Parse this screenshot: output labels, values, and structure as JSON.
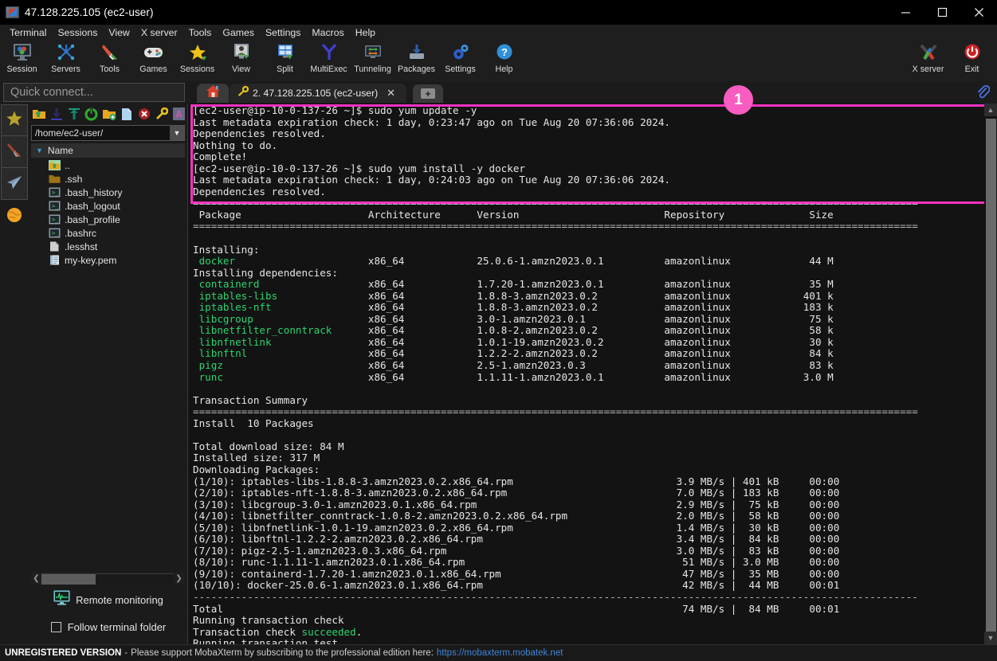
{
  "window": {
    "title": "47.128.225.105 (ec2-user)",
    "icon": "mobaxterm-icon",
    "controls": [
      {
        "name": "minimize-button",
        "glyph": "minimize-icon"
      },
      {
        "name": "maximize-button",
        "glyph": "maximize-icon"
      },
      {
        "name": "close-button",
        "glyph": "close-icon"
      }
    ]
  },
  "menubar": {
    "items": [
      {
        "label": "Terminal"
      },
      {
        "label": "Sessions"
      },
      {
        "label": "View"
      },
      {
        "label": "X server"
      },
      {
        "label": "Tools"
      },
      {
        "label": "Games"
      },
      {
        "label": "Settings"
      },
      {
        "label": "Macros"
      },
      {
        "label": "Help"
      }
    ]
  },
  "toolbar": {
    "buttons": [
      {
        "label": "Session",
        "icon": "session-icon"
      },
      {
        "label": "Servers",
        "icon": "servers-icon"
      },
      {
        "label": "Tools",
        "icon": "tools-icon"
      },
      {
        "label": "Games",
        "icon": "games-icon"
      },
      {
        "label": "Sessions",
        "icon": "sessions-star-icon"
      },
      {
        "label": "View",
        "icon": "view-icon"
      },
      {
        "label": "Split",
        "icon": "split-icon"
      },
      {
        "label": "MultiExec",
        "icon": "multiexec-icon"
      },
      {
        "label": "Tunneling",
        "icon": "tunneling-icon"
      },
      {
        "label": "Packages",
        "icon": "packages-icon"
      },
      {
        "label": "Settings",
        "icon": "settings-gear-icon"
      },
      {
        "label": "Help",
        "icon": "help-icon"
      }
    ],
    "right_buttons": [
      {
        "label": "X server",
        "icon": "xserver-icon"
      },
      {
        "label": "Exit",
        "icon": "exit-power-icon"
      }
    ]
  },
  "quick_connect": {
    "placeholder": "Quick connect..."
  },
  "rail": {
    "items": [
      {
        "name": "sidebar-sessions-star",
        "icon": "star-icon"
      },
      {
        "name": "sidebar-tools",
        "icon": "swiss-knife-icon"
      },
      {
        "name": "sidebar-sftp",
        "icon": "paper-plane-icon"
      },
      {
        "name": "sidebar-globe",
        "icon": "globe-icon"
      }
    ]
  },
  "file_browser": {
    "toolbar_icons": [
      "up-folder-icon",
      "download-icon",
      "upload-icon",
      "refresh-icon",
      "new-folder-icon",
      "new-file-icon",
      "delete-icon",
      "permissions-key-icon",
      "text-mode-icon"
    ],
    "path": "/home/ec2-user/",
    "column_header": "Name",
    "sort_indicator": "sort-descending-icon",
    "files": [
      {
        "name": "..",
        "icon": "parent-folder-icon"
      },
      {
        "name": ".ssh",
        "icon": "folder-icon"
      },
      {
        "name": ".bash_history",
        "icon": "script-file-icon"
      },
      {
        "name": ".bash_logout",
        "icon": "script-file-icon"
      },
      {
        "name": ".bash_profile",
        "icon": "script-file-icon"
      },
      {
        "name": ".bashrc",
        "icon": "script-file-icon"
      },
      {
        "name": ".lesshst",
        "icon": "plain-file-icon"
      },
      {
        "name": "my-key.pem",
        "icon": "certificate-file-icon"
      }
    ],
    "remote_monitoring_label": "Remote monitoring",
    "remote_monitoring_icon": "monitor-graph-icon",
    "follow_terminal_folder_label": "Follow terminal folder",
    "follow_terminal_folder_checked": false
  },
  "tabs": {
    "home_tab_icon": "home-icon",
    "session_tab": {
      "icon": "key-icon",
      "label": "2. 47.128.225.105 (ec2-user)",
      "close_glyph": "close-icon"
    },
    "new_tab_label": "+",
    "clipboard_icon": "paperclip-icon"
  },
  "annotation": {
    "badge_number": "1",
    "highlight_color": "#f734c0",
    "badge_color": "#f85cc0"
  },
  "terminal": {
    "scroll_up_glyph": "chevron-up-icon",
    "scroll_down_glyph": "chevron-down-icon",
    "lines": [
      {
        "t": "[ec2-user@ip-10-0-137-26 ~]$ sudo yum update -y"
      },
      {
        "t": "Last metadata expiration check: 1 day, 0:23:47 ago on Tue Aug 20 07:36:06 2024."
      },
      {
        "t": "Dependencies resolved."
      },
      {
        "t": "Nothing to do."
      },
      {
        "t": "Complete!"
      },
      {
        "t": "[ec2-user@ip-10-0-137-26 ~]$ sudo yum install -y docker"
      },
      {
        "t": "Last metadata expiration check: 1 day, 0:24:03 ago on Tue Aug 20 07:36:06 2024."
      },
      {
        "t": "Dependencies resolved."
      },
      {
        "t": "========================================================================================================================",
        "c": "sep"
      },
      {
        "t": " Package                     Architecture      Version                        Repository              Size"
      },
      {
        "t": "========================================================================================================================",
        "c": "sep"
      },
      {
        "t": ""
      },
      {
        "t": "Installing:"
      },
      {
        "t": " docker",
        "c": "g",
        "rest": "                      x86_64            25.0.6-1.amzn2023.0.1          amazonlinux             44 M"
      },
      {
        "t": "Installing dependencies:"
      },
      {
        "t": " containerd",
        "c": "g",
        "rest": "                  x86_64            1.7.20-1.amzn2023.0.1          amazonlinux             35 M"
      },
      {
        "t": " iptables-libs",
        "c": "g",
        "rest": "               x86_64            1.8.8-3.amzn2023.0.2           amazonlinux            401 k"
      },
      {
        "t": " iptables-nft",
        "c": "g",
        "rest": "                x86_64            1.8.8-3.amzn2023.0.2           amazonlinux            183 k"
      },
      {
        "t": " libcgroup",
        "c": "g",
        "rest": "                   x86_64            3.0-1.amzn2023.0.1             amazonlinux             75 k"
      },
      {
        "t": " libnetfilter_conntrack",
        "c": "g",
        "rest": "      x86_64            1.0.8-2.amzn2023.0.2           amazonlinux             58 k"
      },
      {
        "t": " libnfnetlink",
        "c": "g",
        "rest": "                x86_64            1.0.1-19.amzn2023.0.2          amazonlinux             30 k"
      },
      {
        "t": " libnftnl",
        "c": "g",
        "rest": "                    x86_64            1.2.2-2.amzn2023.0.2           amazonlinux             84 k"
      },
      {
        "t": " pigz",
        "c": "g",
        "rest": "                        x86_64            2.5-1.amzn2023.0.3             amazonlinux             83 k"
      },
      {
        "t": " runc",
        "c": "g",
        "rest": "                        x86_64            1.1.11-1.amzn2023.0.1          amazonlinux            3.0 M"
      },
      {
        "t": ""
      },
      {
        "t": "Transaction Summary"
      },
      {
        "t": "========================================================================================================================",
        "c": "sep"
      },
      {
        "t": "Install  10 Packages"
      },
      {
        "t": ""
      },
      {
        "t": "Total download size: 84 M"
      },
      {
        "t": "Installed size: 317 M"
      },
      {
        "t": "Downloading Packages:"
      },
      {
        "t": "(1/10): iptables-libs-1.8.8-3.amzn2023.0.2.x86_64.rpm                           3.9 MB/s | 401 kB     00:00"
      },
      {
        "t": "(2/10): iptables-nft-1.8.8-3.amzn2023.0.2.x86_64.rpm                            7.0 MB/s | 183 kB     00:00"
      },
      {
        "t": "(3/10): libcgroup-3.0-1.amzn2023.0.1.x86_64.rpm                                 2.9 MB/s |  75 kB     00:00"
      },
      {
        "t": "(4/10): libnetfilter_conntrack-1.0.8-2.amzn2023.0.2.x86_64.rpm                  2.0 MB/s |  58 kB     00:00"
      },
      {
        "t": "(5/10): libnfnetlink-1.0.1-19.amzn2023.0.2.x86_64.rpm                           1.4 MB/s |  30 kB     00:00"
      },
      {
        "t": "(6/10): libnftnl-1.2.2-2.amzn2023.0.2.x86_64.rpm                                3.4 MB/s |  84 kB     00:00"
      },
      {
        "t": "(7/10): pigz-2.5-1.amzn2023.0.3.x86_64.rpm                                      3.0 MB/s |  83 kB     00:00"
      },
      {
        "t": "(8/10): runc-1.1.11-1.amzn2023.0.1.x86_64.rpm                                    51 MB/s | 3.0 MB     00:00"
      },
      {
        "t": "(9/10): containerd-1.7.20-1.amzn2023.0.1.x86_64.rpm                              47 MB/s |  35 MB     00:00"
      },
      {
        "t": "(10/10): docker-25.0.6-1.amzn2023.0.1.x86_64.rpm                                 42 MB/s |  44 MB     00:01"
      },
      {
        "t": "------------------------------------------------------------------------------------------------------------------------",
        "c": "sep"
      },
      {
        "t": "Total                                                                            74 MB/s |  84 MB     00:01"
      },
      {
        "t": "Running transaction check"
      },
      {
        "t": "Transaction check ",
        "c": "w",
        "green_tail": "succeeded",
        "tail": "."
      },
      {
        "t": "Running transaction test"
      }
    ]
  },
  "statusbar": {
    "unregistered": "UNREGISTERED VERSION",
    "dash": "-",
    "message": "Please support MobaXterm by subscribing to the professional edition here:",
    "link": "https://mobaxterm.mobatek.net"
  }
}
